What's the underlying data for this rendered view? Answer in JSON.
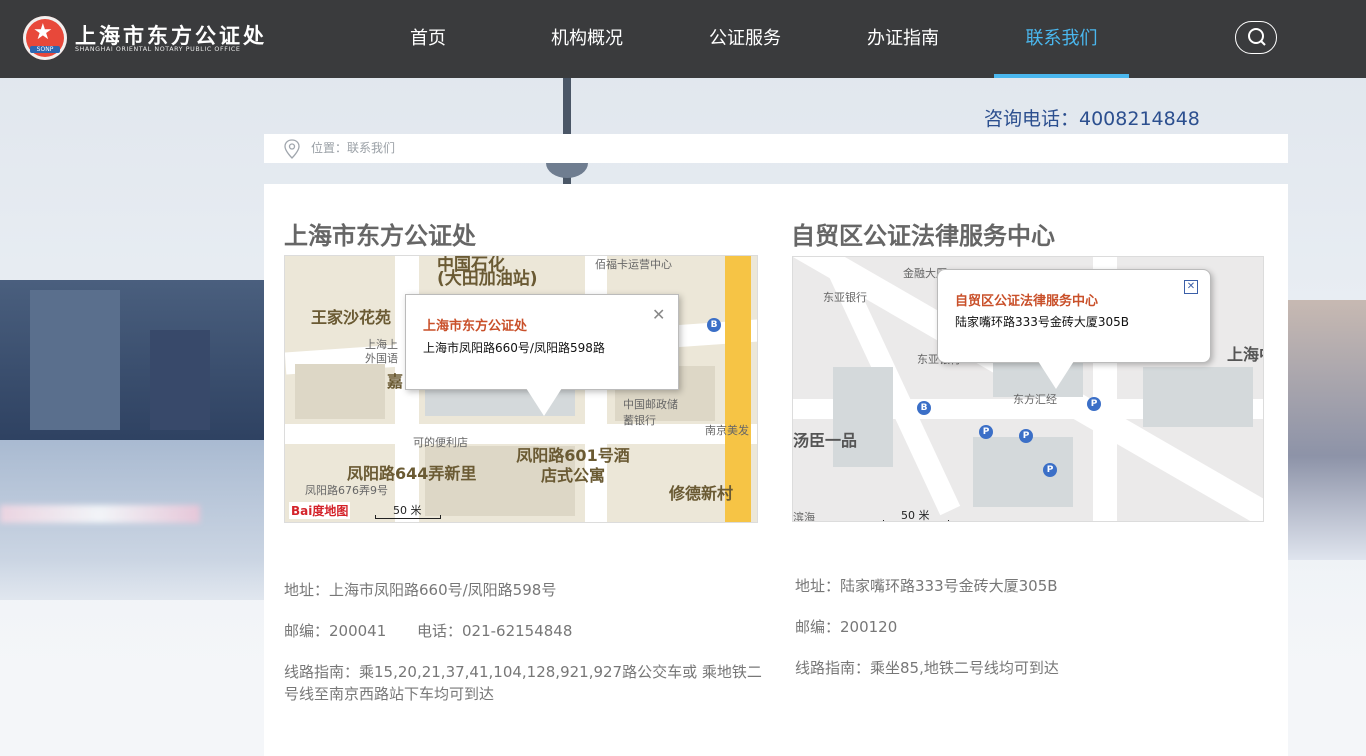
{
  "header": {
    "logo_cn": "上海市东方公证处",
    "logo_en": "SHANGHAI ORIENTAL NOTARY PUBLIC OFFICE",
    "logo_badge": "SONP",
    "nav": [
      {
        "label": "首页"
      },
      {
        "label": "机构概况"
      },
      {
        "label": "公证服务"
      },
      {
        "label": "办证指南"
      },
      {
        "label": "联系我们"
      }
    ],
    "active_nav": "联系我们",
    "search_icon": "search-icon"
  },
  "hotline": "咨询电话：4008214848",
  "breadcrumb": {
    "text": "位置：联系我们"
  },
  "offices": [
    {
      "title": "上海市东方公证处",
      "map": {
        "labels": [
          "中国石化",
          "(大田加油站)",
          "佰福卡运营中心",
          "王家沙花苑",
          "上海上",
          "外国语",
          "嘉",
          "中国邮政储蓄银行",
          "可的便利店",
          "南京美发",
          "凤阳路644弄新里",
          "凤阳路601号酒店式公寓",
          "凤阳路676弄9号",
          "修德新村"
        ],
        "popup_title": "上海市东方公证处",
        "popup_address": "上海市凤阳路660号/凤阳路598路",
        "scale": "50 米",
        "logo": "Bai度地图"
      },
      "address": "地址：上海市凤阳路660号/凤阳路598号",
      "postcode": "邮编：200041",
      "phone": "电话：021-62154848",
      "route": "线路指南：乘15,20,21,37,41,104,128,921,927路公交车或 乘地铁二号线至南京西路站下车均可到达"
    },
    {
      "title": "自贸区公证法律服务中心",
      "map": {
        "labels": [
          "东亚银行",
          "金融大厦",
          "东亚银行",
          "东方汇经",
          "汤臣一品",
          "上海中",
          "滨海"
        ],
        "popup_title": "自贸区公证法律服务中心",
        "popup_address": "陆家嘴环路333号金砖大厦305B",
        "scale": "50 米"
      },
      "address": "地址：陆家嘴环路333号金砖大厦305B",
      "postcode": "邮编：200120",
      "route": "线路指南：乘坐85,地铁二号线均可到达"
    }
  ],
  "colors": {
    "header_bg": "#3a3b3d",
    "accent": "#4ab7ee",
    "hotline": "#2c4f8f",
    "popup_title": "#c9502a"
  }
}
